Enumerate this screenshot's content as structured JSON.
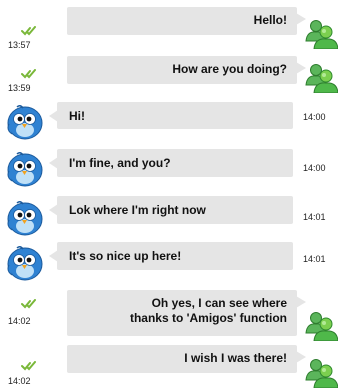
{
  "colors": {
    "bubble": "#e5e5e5",
    "check": "#7ab83a",
    "user_avatar": "#3a9a3a",
    "bird_avatar": "#2d76c0"
  },
  "icons": {
    "sent_check": "double-check-icon",
    "contact_avatar": "msn-users-icon",
    "friend_avatar": "blue-bird-icon"
  },
  "messages": [
    {
      "direction": "out",
      "text": "Hello!",
      "time": "13:57"
    },
    {
      "direction": "out",
      "text": "How are you doing?",
      "time": "13:59"
    },
    {
      "direction": "in",
      "text": "Hi!",
      "time": "14:00"
    },
    {
      "direction": "in",
      "text": "I'm fine, and you?",
      "time": "14:00"
    },
    {
      "direction": "in",
      "text": "Lok where I'm right now",
      "time": "14:01"
    },
    {
      "direction": "in",
      "text": "It's so nice up here!",
      "time": "14:01"
    },
    {
      "direction": "out",
      "text_line1": "Oh yes, I can see where",
      "text_line2": "thanks to 'Amigos' function",
      "time": "14:02"
    },
    {
      "direction": "out",
      "text": "I wish I was there!",
      "time": "14:02"
    }
  ]
}
